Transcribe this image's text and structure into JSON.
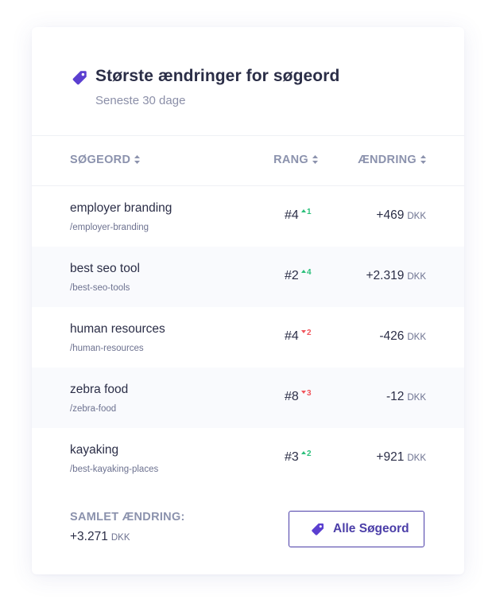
{
  "header": {
    "title": "Største ændringer for søgeord",
    "subtitle": "Seneste 30 dage",
    "icon": "tag-icon"
  },
  "columns": {
    "keyword": "SØGEORD",
    "rank": "RANG",
    "change": "ÆNDRING"
  },
  "rows": [
    {
      "keyword": "employer branding",
      "path": "/employer-branding",
      "rank": "#4",
      "delta": "1",
      "direction": "up",
      "change": "+469",
      "currency": "DKK"
    },
    {
      "keyword": "best seo tool",
      "path": "/best-seo-tools",
      "rank": "#2",
      "delta": "4",
      "direction": "up",
      "change": "+2.319",
      "currency": "DKK"
    },
    {
      "keyword": "human resources",
      "path": "/human-resources",
      "rank": "#4",
      "delta": "2",
      "direction": "down",
      "change": "-426",
      "currency": "DKK"
    },
    {
      "keyword": "zebra food",
      "path": "/zebra-food",
      "rank": "#8",
      "delta": "3",
      "direction": "down",
      "change": "-12",
      "currency": "DKK"
    },
    {
      "keyword": "kayaking",
      "path": "/best-kayaking-places",
      "rank": "#3",
      "delta": "2",
      "direction": "up",
      "change": "+921",
      "currency": "DKK"
    }
  ],
  "footer": {
    "total_label": "SAMLET ÆNDRING:",
    "total_value": "+3.271",
    "total_currency": "DKK",
    "button_label": "Alle Søgeord"
  },
  "colors": {
    "accent": "#4b3ea8",
    "icon": "#5b3fd0",
    "up": "#2bbf7a",
    "down": "#f0555c",
    "muted": "#8b92ad"
  }
}
